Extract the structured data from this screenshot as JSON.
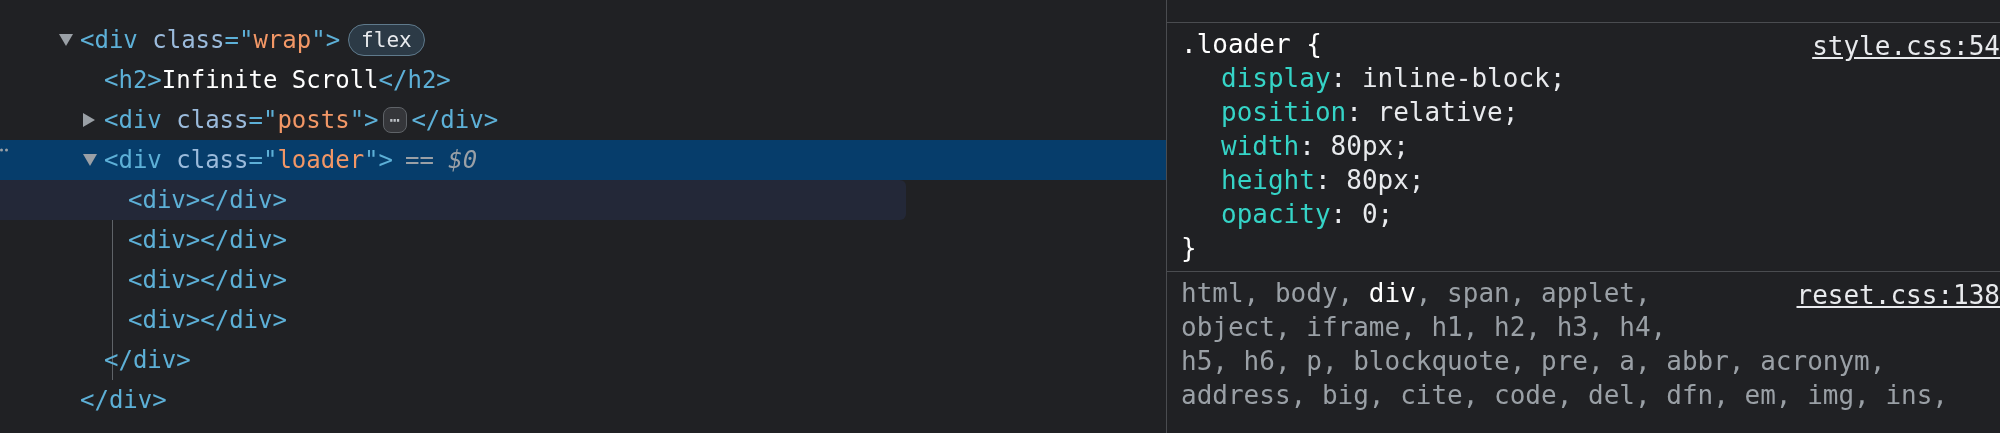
{
  "elements_tree": [
    {
      "tokens": [
        {
          "kind": "tag",
          "text": "<div"
        },
        {
          "kind": "attr",
          "text": "class"
        },
        {
          "kind": "tag",
          "text": "=\""
        },
        {
          "kind": "value",
          "text": "wrap"
        },
        {
          "kind": "tag",
          "text": "\">"
        }
      ],
      "expanded": true,
      "selected": false,
      "hovered": false,
      "badge": "flex",
      "closing": "</div>",
      "children": [
        {
          "tokens": [
            {
              "kind": "tag",
              "text": "<h2>"
            },
            {
              "kind": "text",
              "text": "Infinite Scroll"
            },
            {
              "kind": "tag",
              "text": "</h2>"
            }
          ],
          "selected": false,
          "hovered": false
        },
        {
          "tokens": [
            {
              "kind": "tag",
              "text": "<div"
            },
            {
              "kind": "attr",
              "text": "class"
            },
            {
              "kind": "tag",
              "text": "=\""
            },
            {
              "kind": "value",
              "text": "posts"
            },
            {
              "kind": "tag",
              "text": "\">"
            }
          ],
          "expanded": false,
          "selected": false,
          "hovered": false,
          "ellipsis": "⋯",
          "tail": "</div>"
        },
        {
          "tokens": [
            {
              "kind": "tag",
              "text": "<div"
            },
            {
              "kind": "attr",
              "text": "class"
            },
            {
              "kind": "tag",
              "text": "=\""
            },
            {
              "kind": "value",
              "text": "loader"
            },
            {
              "kind": "tag",
              "text": "\">"
            }
          ],
          "expanded": true,
          "selected": true,
          "hovered": false,
          "suffix": "== $0",
          "closing": "</div>",
          "children": [
            {
              "tokens": [
                {
                  "kind": "tag",
                  "text": "<div></div>"
                }
              ],
              "selected": false,
              "hovered": true
            },
            {
              "tokens": [
                {
                  "kind": "tag",
                  "text": "<div></div>"
                }
              ],
              "selected": false,
              "hovered": false
            },
            {
              "tokens": [
                {
                  "kind": "tag",
                  "text": "<div></div>"
                }
              ],
              "selected": false,
              "hovered": false
            },
            {
              "tokens": [
                {
                  "kind": "tag",
                  "text": "<div></div>"
                }
              ],
              "selected": false,
              "hovered": false
            }
          ]
        }
      ]
    }
  ],
  "styles_pane": [
    {
      "kind": "rule",
      "selector_lines": [
        [
          {
            "text": ".loader",
            "matched": true
          }
        ]
      ],
      "open_brace": "{",
      "close_brace": "}",
      "source": "style.css:54",
      "properties": [
        {
          "name": "display",
          "colon": ":",
          "value": "inline-block;"
        },
        {
          "name": "position",
          "colon": ":",
          "value": "relative;"
        },
        {
          "name": "width",
          "colon": ":",
          "value": "80px;"
        },
        {
          "name": "height",
          "colon": ":",
          "value": "80px;"
        },
        {
          "name": "opacity",
          "colon": ":",
          "value": "0;"
        }
      ]
    },
    {
      "kind": "rule",
      "source": "reset.css:138",
      "selector_lines": [
        [
          {
            "text": "html, body, ",
            "matched": false
          },
          {
            "text": "div",
            "matched": true
          },
          {
            "text": ", span, applet,",
            "matched": false
          }
        ],
        [
          {
            "text": "object, iframe, h1, h2, h3, h4,",
            "matched": false
          }
        ],
        [
          {
            "text": "h5, h6, p, blockquote, pre, a, abbr, acronym,",
            "matched": false
          }
        ],
        [
          {
            "text": "address, big, cite, code, del, dfn, em, img, ins,",
            "matched": false
          }
        ]
      ]
    }
  ]
}
